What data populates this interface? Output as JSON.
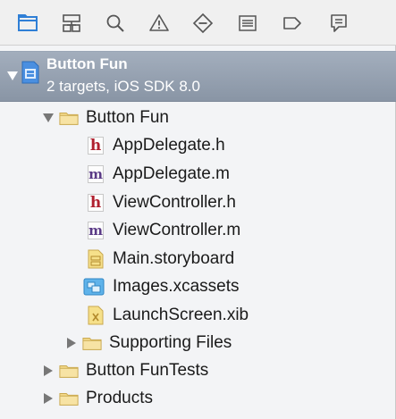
{
  "project": {
    "title": "Button Fun",
    "subtitle": "2 targets, iOS SDK 8.0"
  },
  "toolbar": {
    "items": [
      {
        "icon": "folder-icon",
        "selected": true
      },
      {
        "icon": "hierarchy-icon",
        "selected": false
      },
      {
        "icon": "search-icon",
        "selected": false
      },
      {
        "icon": "warning-icon",
        "selected": false
      },
      {
        "icon": "test-diamond-icon",
        "selected": false
      },
      {
        "icon": "debug-list-icon",
        "selected": false
      },
      {
        "icon": "breakpoint-icon",
        "selected": false
      },
      {
        "icon": "log-bubble-icon",
        "selected": false
      }
    ]
  },
  "tree": {
    "group_button_fun": "Button Fun",
    "files": [
      {
        "label": "AppDelegate.h",
        "type": "h"
      },
      {
        "label": "AppDelegate.m",
        "type": "m"
      },
      {
        "label": "ViewController.h",
        "type": "h"
      },
      {
        "label": "ViewController.m",
        "type": "m"
      },
      {
        "label": "Main.storyboard",
        "type": "storyboard"
      },
      {
        "label": "Images.xcassets",
        "type": "xcassets"
      },
      {
        "label": "LaunchScreen.xib",
        "type": "xib"
      }
    ],
    "supporting_files": "Supporting Files",
    "group_tests": "Button FunTests",
    "group_products": "Products"
  },
  "colors": {
    "selected_tool": "#2f7fd6",
    "tool": "#555555",
    "project_row": "#8e9aab",
    "folder": "#f3d98a"
  }
}
